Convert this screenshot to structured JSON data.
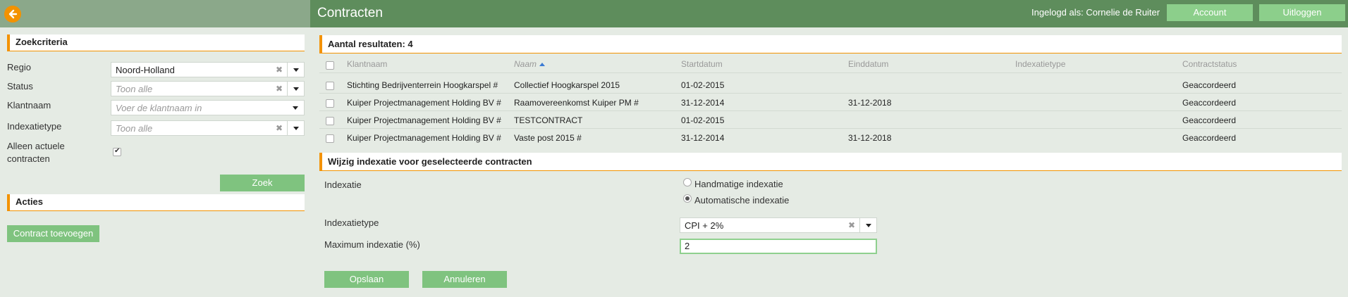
{
  "header": {
    "title": "Contracten",
    "login_info": "Ingelogd als: Cornelie de Ruiter",
    "account_label": "Account",
    "logout_label": "Uitloggen"
  },
  "sidebar": {
    "search_title": "Zoekcriteria",
    "fields": {
      "regio": {
        "label": "Regio",
        "value": "Noord-Holland"
      },
      "status": {
        "label": "Status",
        "placeholder": "Toon alle"
      },
      "klantnaam": {
        "label": "Klantnaam",
        "placeholder": "Voer de klantnaam in"
      },
      "indexatietype": {
        "label": "Indexatietype",
        "placeholder": "Toon alle"
      },
      "actueel": {
        "label_line1": "Alleen actuele",
        "label_line2": "contracten",
        "checked": true
      }
    },
    "search_button": "Zoek",
    "actions_title": "Acties",
    "add_contract_button": "Contract toevoegen"
  },
  "results": {
    "title": "Aantal resultaten: 4",
    "columns": [
      "Klantnaam",
      "Naam",
      "Startdatum",
      "Einddatum",
      "Indexatietype",
      "Contractstatus"
    ],
    "sorted_column": "Naam",
    "rows": [
      {
        "klant": "Stichting Bedrijventerrein Hoogkarspel #",
        "naam": "Collectief Hoogkarspel 2015",
        "start": "01-02-2015",
        "eind": "",
        "type": "",
        "status": "Geaccordeerd"
      },
      {
        "klant": "Kuiper Projectmanagement Holding BV #",
        "naam": "Raamovereenkomst Kuiper PM #",
        "start": "31-12-2014",
        "eind": "31-12-2018",
        "type": "",
        "status": "Geaccordeerd"
      },
      {
        "klant": "Kuiper Projectmanagement Holding BV #",
        "naam": "TESTCONTRACT",
        "start": "01-02-2015",
        "eind": "",
        "type": "",
        "status": "Geaccordeerd"
      },
      {
        "klant": "Kuiper Projectmanagement Holding BV #",
        "naam": "Vaste post 2015 #",
        "start": "31-12-2014",
        "eind": "31-12-2018",
        "type": "",
        "status": "Geaccordeerd"
      }
    ]
  },
  "edit": {
    "title": "Wijzig indexatie voor geselecteerde contracten",
    "indexatie_label": "Indexatie",
    "option_manual": "Handmatige indexatie",
    "option_auto": "Automatische indexatie",
    "selected_option": "auto",
    "type_label": "Indexatietype",
    "type_value": "CPI + 2%",
    "max_label": "Maximum indexatie (%)",
    "max_value": "2",
    "save_button": "Opslaan",
    "cancel_button": "Annuleren"
  },
  "colors": {
    "header_green": "#5e8d5c",
    "button_green": "#7fc37f",
    "accent_orange": "#f39200",
    "panel_bg": "#e5ebe4"
  }
}
